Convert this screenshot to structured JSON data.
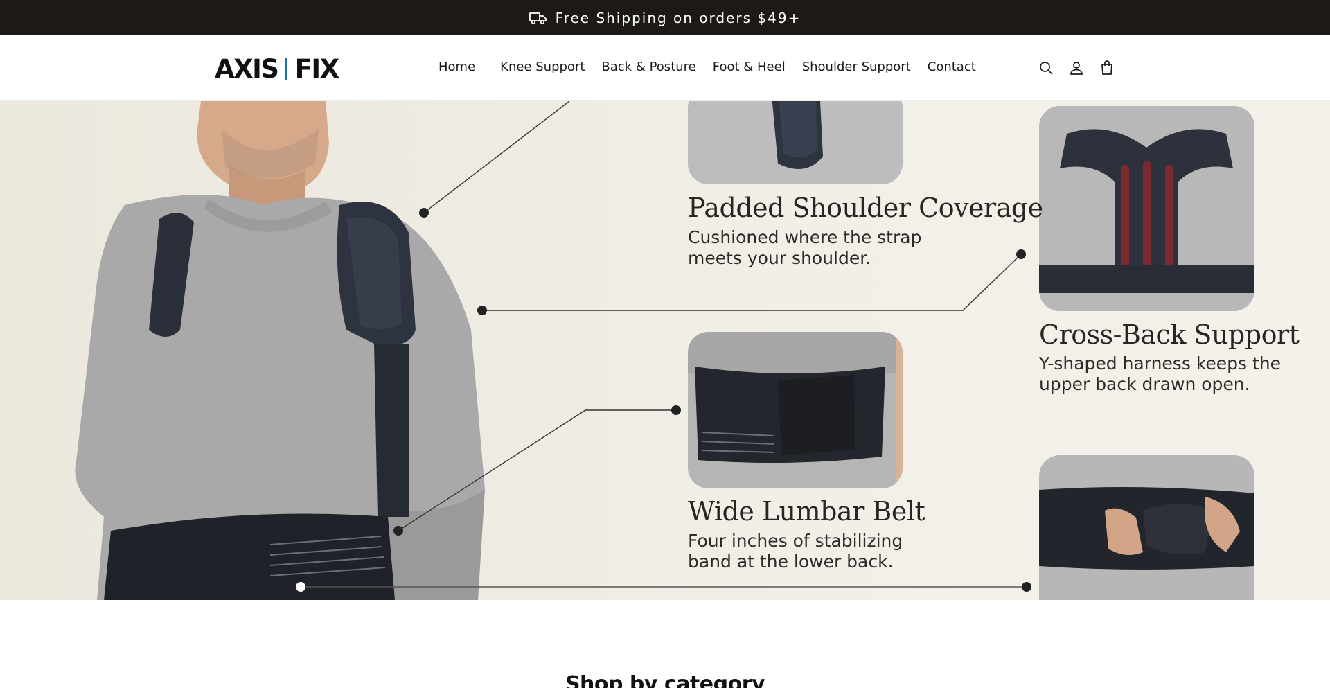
{
  "announcement": {
    "text": "Free Shipping on orders $49+",
    "icon": "truck-icon"
  },
  "brand": {
    "left": "AXIS",
    "right": "FIX",
    "accent_color": "#1f74b8"
  },
  "nav": {
    "home": "Home",
    "items": [
      "Knee Support",
      "Back & Posture",
      "Foot & Heel",
      "Shoulder Support",
      "Contact"
    ]
  },
  "header_icons": [
    "search-icon",
    "account-icon",
    "cart-icon"
  ],
  "hero": {
    "features": [
      {
        "title": "Padded Shoulder Coverage",
        "desc_line1": "Cushioned where the strap",
        "desc_line2": "meets your shoulder."
      },
      {
        "title": "Cross-Back Support",
        "desc_line1": "Y-shaped harness keeps the",
        "desc_line2": "upper back drawn open."
      },
      {
        "title": "Wide Lumbar Belt",
        "desc_line1": "Four inches of stabilizing",
        "desc_line2": "band at the lower back."
      }
    ]
  },
  "section": {
    "heading": "Shop by category"
  }
}
